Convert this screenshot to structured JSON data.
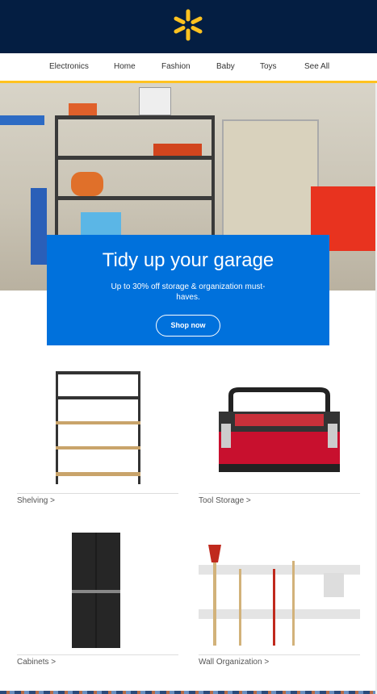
{
  "header": {
    "logo": "walmart-spark"
  },
  "nav": {
    "items": [
      "Electronics",
      "Home",
      "Fashion",
      "Baby",
      "Toys",
      "See All"
    ]
  },
  "hero": {
    "title": "Tidy up your garage",
    "subtitle": "Up to 30% off storage & organization must-haves.",
    "button": "Shop now"
  },
  "categories": [
    {
      "label": "Shelving >"
    },
    {
      "label": "Tool Storage >"
    },
    {
      "label": "Cabinets >"
    },
    {
      "label": "Wall Organization >"
    }
  ],
  "colors": {
    "navy": "#041e42",
    "yellow": "#ffc220",
    "blue": "#0071dc"
  }
}
